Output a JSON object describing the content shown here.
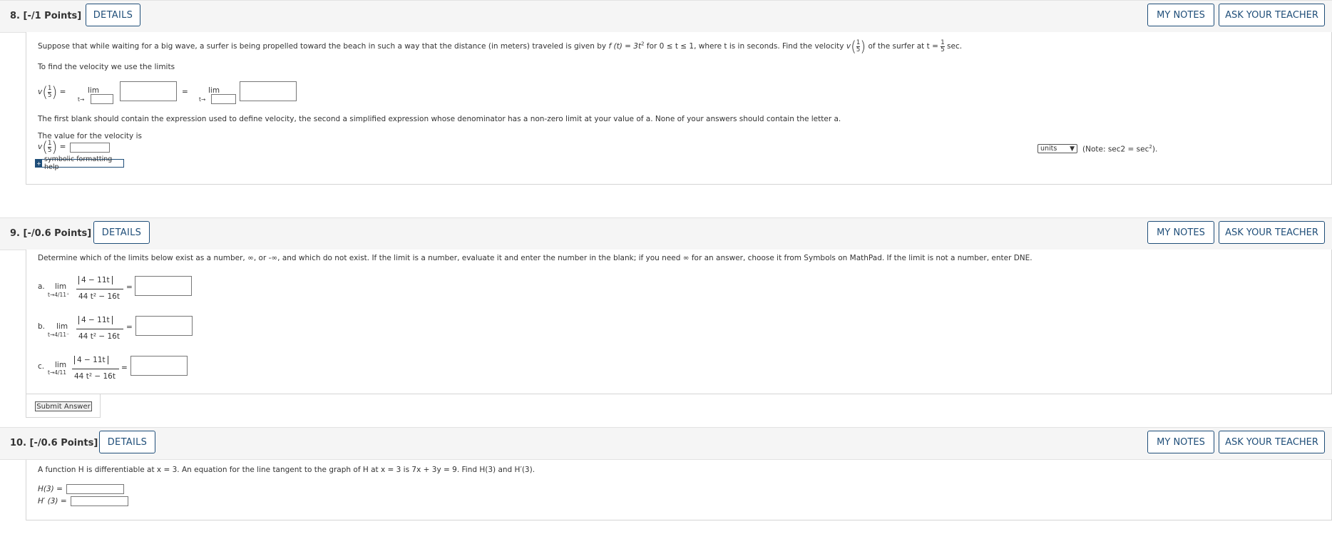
{
  "details_label": "DETAILS",
  "my_notes_label": "MY NOTES",
  "ask_teacher_label": "ASK YOUR TEACHER",
  "q8": {
    "title": "8.  [-/1 Points]",
    "prompt_a": "Suppose that while waiting for a big wave, a surfer is being propelled toward the beach in such a way that the distance (in meters) traveled is given by",
    "prompt_b": "for 0 ≤ t ≤ 1, where t is in seconds. Find the velocity",
    "prompt_c": "of the surfer at t =",
    "prompt_d": "sec.",
    "func": "f (t) = 3t",
    "intro": "To find the velocity we use the limits",
    "v_label": "v",
    "frac_num": "1",
    "frac_den": "5",
    "equals": "=",
    "lim": "lim",
    "t_to": "t→",
    "instructions": "The first blank should contain the expression used to define velocity, the second a simplified expression whose denominator has a non-zero limit at your value of a. None of your answers should contain the letter a.",
    "value_intro": "The value for the velocity is",
    "units_option": "units",
    "note": "(Note: sec2 = sec",
    "help_label": "symbolic formatting help"
  },
  "q9": {
    "title": "9.  [-/0.6 Points]",
    "prompt": "Determine which of the limits below exist as a number, ∞, or -∞, and which do not exist. If the limit is a number, evaluate it and enter the number in the blank; if you need ∞ for an answer, choose it from Symbols on MathPad. If the limit is not a number, enter DNE.",
    "parts": [
      {
        "letter": "a.",
        "sub": "t→4/11⁺"
      },
      {
        "letter": "b.",
        "sub": "t→4/11⁻"
      },
      {
        "letter": "c.",
        "sub": "t→4/11"
      }
    ],
    "numerator": "4 − 11t",
    "denominator": "44 t² − 16t",
    "lim": "lim",
    "submit_label": "Submit Answer"
  },
  "q10": {
    "title": "10.  [-/0.6 Points]",
    "prompt": "A function H is differentiable at x = 3. An equation for the line tangent to the graph of H at x = 3 is 7x + 3y = 9. Find H(3) and H′(3).",
    "h_label": "H(3) =",
    "hp_label": "H′ (3) ="
  }
}
